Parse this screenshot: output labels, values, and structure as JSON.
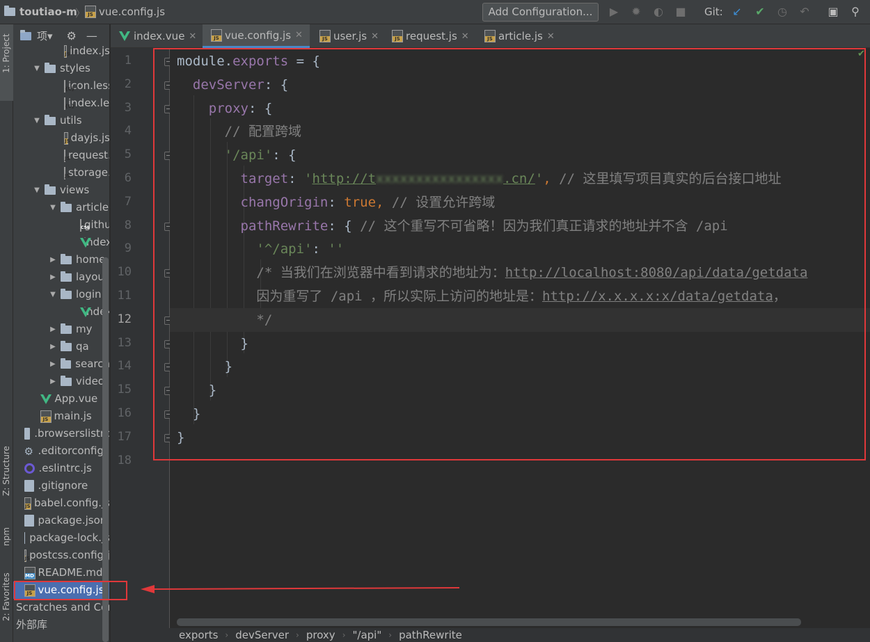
{
  "topbar": {
    "project": "toutiao-m",
    "file": "vue.config.js",
    "add_config": "Add Configuration...",
    "git_label": "Git:"
  },
  "left_strip": {
    "project_tab": "1: Project",
    "structure_tab": "Z: Structure",
    "npm_tab": "npm",
    "favorites_tab": "2: Favorites"
  },
  "project_panel": {
    "header": "项▾",
    "tree": [
      {
        "label": "index.js",
        "icon": "js",
        "indent": 2,
        "arrow": ""
      },
      {
        "label": "styles",
        "icon": "folder",
        "indent": 0,
        "arrow": "down"
      },
      {
        "label": "icon.less",
        "icon": "less",
        "indent": 2,
        "arrow": ""
      },
      {
        "label": "index.less",
        "icon": "less",
        "indent": 2,
        "arrow": ""
      },
      {
        "label": "utils",
        "icon": "folder",
        "indent": 0,
        "arrow": "down"
      },
      {
        "label": "dayjs.js",
        "icon": "js",
        "indent": 2,
        "arrow": ""
      },
      {
        "label": "request.js",
        "icon": "js",
        "indent": 2,
        "arrow": ""
      },
      {
        "label": "storage.js",
        "icon": "js",
        "indent": 2,
        "arrow": ""
      },
      {
        "label": "views",
        "icon": "folder",
        "indent": 0,
        "arrow": "down"
      },
      {
        "label": "article",
        "icon": "folder",
        "indent": 1,
        "arrow": "down"
      },
      {
        "label": "github",
        "icon": "css",
        "indent": 3,
        "arrow": ""
      },
      {
        "label": "index.",
        "icon": "vue",
        "indent": 3,
        "arrow": ""
      },
      {
        "label": "home",
        "icon": "folder",
        "indent": 1,
        "arrow": "right"
      },
      {
        "label": "layout",
        "icon": "folder",
        "indent": 1,
        "arrow": "right"
      },
      {
        "label": "login",
        "icon": "folder",
        "indent": 1,
        "arrow": "down"
      },
      {
        "label": "index.",
        "icon": "vue",
        "indent": 3,
        "arrow": ""
      },
      {
        "label": "my",
        "icon": "folder",
        "indent": 1,
        "arrow": "right"
      },
      {
        "label": "qa",
        "icon": "folder",
        "indent": 1,
        "arrow": "right"
      },
      {
        "label": "search",
        "icon": "folder",
        "indent": 1,
        "arrow": "right"
      },
      {
        "label": "video",
        "icon": "folder",
        "indent": 1,
        "arrow": "right"
      },
      {
        "label": "App.vue",
        "icon": "vue",
        "indent": 0.5,
        "arrow": ""
      },
      {
        "label": "main.js",
        "icon": "js",
        "indent": 0.5,
        "arrow": ""
      },
      {
        "label": ".browserslistrc",
        "icon": "generic",
        "indent": -0.5,
        "arrow": ""
      },
      {
        "label": ".editorconfig",
        "icon": "gear",
        "indent": -0.5,
        "arrow": ""
      },
      {
        "label": ".eslintrc.js",
        "icon": "eslint",
        "indent": -0.5,
        "arrow": ""
      },
      {
        "label": ".gitignore",
        "icon": "generic",
        "indent": -0.5,
        "arrow": ""
      },
      {
        "label": "babel.config.js",
        "icon": "js",
        "indent": -0.5,
        "arrow": ""
      },
      {
        "label": "package.json",
        "icon": "generic",
        "indent": -0.5,
        "arrow": ""
      },
      {
        "label": "package-lock.js",
        "icon": "generic",
        "indent": -0.5,
        "arrow": ""
      },
      {
        "label": "postcss.config.j",
        "icon": "js",
        "indent": -0.5,
        "arrow": ""
      },
      {
        "label": "README.md",
        "icon": "md",
        "indent": -0.5,
        "arrow": ""
      },
      {
        "label": "vue.config.js",
        "icon": "js",
        "indent": -0.5,
        "arrow": "",
        "selected": true
      },
      {
        "label": "Scratches and Con",
        "icon": "none",
        "indent": -1,
        "arrow": ""
      },
      {
        "label": "外部库",
        "icon": "none",
        "indent": -1,
        "arrow": ""
      }
    ]
  },
  "tabs": [
    {
      "label": "index.vue",
      "icon": "vue",
      "active": false
    },
    {
      "label": "vue.config.js",
      "icon": "js",
      "active": true
    },
    {
      "label": "user.js",
      "icon": "js",
      "active": false
    },
    {
      "label": "request.js",
      "icon": "js",
      "active": false
    },
    {
      "label": "article.js",
      "icon": "js",
      "active": false
    }
  ],
  "editor": {
    "current_line": 12,
    "line_numbers": [
      "1",
      "2",
      "3",
      "4",
      "5",
      "6",
      "7",
      "8",
      "9",
      "10",
      "11",
      "12",
      "13",
      "14",
      "15",
      "16",
      "17",
      "18"
    ],
    "lines": [
      [
        {
          "t": "module",
          "c": ""
        },
        {
          "t": ".",
          "c": ""
        },
        {
          "t": "exports",
          "c": "pr"
        },
        {
          "t": " = {",
          "c": ""
        }
      ],
      [
        {
          "t": "  ",
          "c": ""
        },
        {
          "t": "devServer",
          "c": "pr"
        },
        {
          "t": ": {",
          "c": ""
        }
      ],
      [
        {
          "t": "    ",
          "c": ""
        },
        {
          "t": "proxy",
          "c": "pr"
        },
        {
          "t": ": {",
          "c": ""
        }
      ],
      [
        {
          "t": "      ",
          "c": ""
        },
        {
          "t": "// 配置跨域",
          "c": "cm"
        }
      ],
      [
        {
          "t": "      ",
          "c": ""
        },
        {
          "t": "'/api'",
          "c": "str"
        },
        {
          "t": ": {",
          "c": ""
        }
      ],
      [
        {
          "t": "        ",
          "c": ""
        },
        {
          "t": "target",
          "c": "pr"
        },
        {
          "t": ": ",
          "c": ""
        },
        {
          "t": "'",
          "c": "str"
        },
        {
          "t": "http://t",
          "c": "lnk-str"
        },
        {
          "t": "xxxxxxxxxxxxxxxx",
          "c": "blur"
        },
        {
          "t": ".cn/",
          "c": "lnk-str"
        },
        {
          "t": "'",
          "c": "str"
        },
        {
          "t": ", ",
          "c": "kw"
        },
        {
          "t": "// 这里填写项目真实的后台接口地址",
          "c": "cm"
        }
      ],
      [
        {
          "t": "        ",
          "c": ""
        },
        {
          "t": "changOrigin",
          "c": "pr"
        },
        {
          "t": ": ",
          "c": ""
        },
        {
          "t": "true",
          "c": "kw"
        },
        {
          "t": ", ",
          "c": "kw"
        },
        {
          "t": "// 设置允许跨域",
          "c": "cm"
        }
      ],
      [
        {
          "t": "        ",
          "c": ""
        },
        {
          "t": "pathRewrite",
          "c": "pr"
        },
        {
          "t": ": { ",
          "c": ""
        },
        {
          "t": "// 这个重写不可省略！因为我们真正请求的地址并不含 /api",
          "c": "cm"
        }
      ],
      [
        {
          "t": "          ",
          "c": ""
        },
        {
          "t": "'^/api'",
          "c": "str"
        },
        {
          "t": ": ",
          "c": ""
        },
        {
          "t": "''",
          "c": "str"
        }
      ],
      [
        {
          "t": "          ",
          "c": ""
        },
        {
          "t": "/* 当我们在浏览器中看到请求的地址为：",
          "c": "cm"
        },
        {
          "t": "http://localhost:8080/api/data/getdata",
          "c": "lnkc"
        }
      ],
      [
        {
          "t": "          ",
          "c": ""
        },
        {
          "t": "因为重写了 /api ，所以实际上访问的地址是：",
          "c": "cm"
        },
        {
          "t": "http://x.x.x.x:x/data/getdata",
          "c": "lnkc"
        },
        {
          "t": "，",
          "c": "cm"
        }
      ],
      [
        {
          "t": "          ",
          "c": ""
        },
        {
          "t": "*/",
          "c": "cm"
        }
      ],
      [
        {
          "t": "        }",
          "c": ""
        }
      ],
      [
        {
          "t": "      }",
          "c": ""
        }
      ],
      [
        {
          "t": "    }",
          "c": ""
        }
      ],
      [
        {
          "t": "  }",
          "c": ""
        }
      ],
      [
        {
          "t": "}",
          "c": ""
        }
      ],
      [
        {
          "t": "",
          "c": ""
        }
      ]
    ]
  },
  "breadcrumb": [
    "exports",
    "devServer",
    "proxy",
    "\"/api\"",
    "pathRewrite"
  ],
  "colors": {
    "accent": "#4a88c7",
    "selection": "#4b6eaf",
    "annotation_red": "#e0383a"
  }
}
